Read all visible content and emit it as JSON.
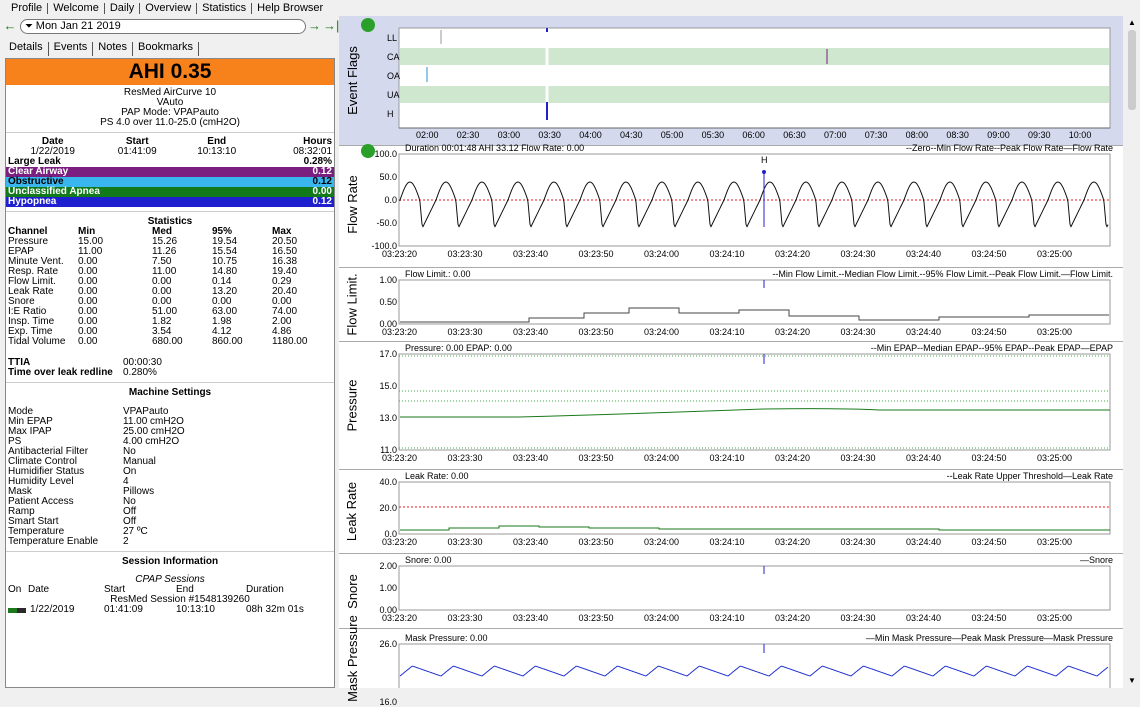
{
  "nav": {
    "tabs": [
      "Profile",
      "Welcome",
      "Daily",
      "Overview",
      "Statistics",
      "Help Browser"
    ]
  },
  "date": {
    "value": "Mon Jan 21 2019"
  },
  "subtabs": [
    "Details",
    "Events",
    "Notes",
    "Bookmarks"
  ],
  "summary": {
    "ahi": "AHI 0.35",
    "device": "ResMed AirCurve 10",
    "mode_short": "VAuto",
    "pap_mode": "PAP Mode: VPAPauto",
    "ps": "PS 4.0 over 11.0-25.0 (cmH2O)"
  },
  "session_head": {
    "labels": [
      "Date",
      "Start",
      "End",
      "Hours"
    ],
    "values": [
      "1/22/2019",
      "01:41:09",
      "10:13:10",
      "08:32:01"
    ]
  },
  "events": [
    {
      "label": "Large Leak",
      "value": "0.28%",
      "color": "#ffffff",
      "text": "#000000"
    },
    {
      "label": "Clear Airway",
      "value": "0.12",
      "color": "#7a1f7f",
      "text": "#ffffff"
    },
    {
      "label": "Obstructive",
      "value": "0.12",
      "color": "#3ab6ee",
      "text": "#000000"
    },
    {
      "label": "Unclassified Apnea",
      "value": "0.00",
      "color": "#137a1c",
      "text": "#ffffff"
    },
    {
      "label": "Hypopnea",
      "value": "0.12",
      "color": "#1e20cf",
      "text": "#ffffff"
    }
  ],
  "stats": {
    "title": "Statistics",
    "headers": [
      "Channel",
      "Min",
      "Med",
      "95%",
      "Max"
    ],
    "rows": [
      [
        "Pressure",
        "15.00",
        "15.26",
        "19.54",
        "20.50"
      ],
      [
        "EPAP",
        "11.00",
        "11.26",
        "15.54",
        "16.50"
      ],
      [
        "Minute Vent.",
        "0.00",
        "7.50",
        "10.75",
        "16.38"
      ],
      [
        "Resp. Rate",
        "0.00",
        "11.00",
        "14.80",
        "19.40"
      ],
      [
        "Flow Limit.",
        "0.00",
        "0.00",
        "0.14",
        "0.29"
      ],
      [
        "Leak Rate",
        "0.00",
        "0.00",
        "13.20",
        "20.40"
      ],
      [
        "Snore",
        "0.00",
        "0.00",
        "0.00",
        "0.00"
      ],
      [
        "I:E Ratio",
        "0.00",
        "51.00",
        "63.00",
        "74.00"
      ],
      [
        "Insp. Time",
        "0.00",
        "1.82",
        "1.98",
        "2.00"
      ],
      [
        "Exp. Time",
        "0.00",
        "3.54",
        "4.12",
        "4.86"
      ],
      [
        "Tidal Volume",
        "0.00",
        "680.00",
        "860.00",
        "1180.00"
      ]
    ]
  },
  "ttia": {
    "label": "TTIA",
    "value": "00:00:30",
    "leak_label": "Time over leak redline",
    "leak_value": "0.280%"
  },
  "machine": {
    "title": "Machine Settings",
    "rows": [
      [
        "Mode",
        "VPAPauto"
      ],
      [
        "Min EPAP",
        "11.00 cmH2O"
      ],
      [
        "Max IPAP",
        "25.00 cmH2O"
      ],
      [
        "PS",
        "4.00 cmH2O"
      ],
      [
        "Antibacterial Filter",
        "No"
      ],
      [
        "Climate Control",
        "Manual"
      ],
      [
        "Humidifier Status",
        "On"
      ],
      [
        "Humidity Level",
        "4"
      ],
      [
        "Mask",
        "Pillows"
      ],
      [
        "Patient Access",
        "No"
      ],
      [
        "Ramp",
        "Off"
      ],
      [
        "Smart Start",
        "Off"
      ],
      [
        "Temperature",
        "27 ºC"
      ],
      [
        "Temperature Enable",
        "2"
      ]
    ]
  },
  "session_info": {
    "title": "Session Information",
    "cpap": "CPAP Sessions",
    "headers": [
      "On",
      "Date",
      "Start",
      "End",
      "Duration"
    ],
    "session_name": "ResMed Session #1548139260",
    "row": [
      "1/22/2019",
      "01:41:09",
      "10:13:10",
      "08h 32m 01s"
    ]
  },
  "flags": {
    "label": "Event Flags",
    "rows": [
      "LL",
      "CA",
      "OA",
      "UA",
      "H"
    ],
    "xticks": [
      "02:00",
      "02:30",
      "03:00",
      "03:30",
      "04:00",
      "04:30",
      "05:00",
      "05:30",
      "06:00",
      "06:30",
      "07:00",
      "07:30",
      "08:00",
      "08:30",
      "09:00",
      "09:30",
      "10:00"
    ]
  },
  "time_ticks": [
    "03:23:20",
    "03:23:30",
    "03:23:40",
    "03:23:50",
    "03:24:00",
    "03:24:10",
    "03:24:20",
    "03:24:30",
    "03:24:40",
    "03:24:50",
    "03:25:00"
  ],
  "graphs": {
    "flow": {
      "label": "Flow Rate",
      "title": "Duration 00:01:48 AHI 33.12 Flow Rate: 0.00",
      "legend": "--Zero--Min Flow Rate--Peak Flow Rate—Flow Rate",
      "yticks": [
        "100.0",
        "50.0",
        "0.0",
        "-50.0",
        "-100.0"
      ],
      "marker": "H"
    },
    "flowlimit": {
      "label": "Flow Limit.",
      "title": "Flow Limit.: 0.00",
      "legend": "--Min Flow Limit.--Median Flow Limit.--95% Flow Limit.--Peak Flow Limit.—Flow Limit.",
      "yticks": [
        "1.00",
        "0.50",
        "0.00"
      ]
    },
    "pressure": {
      "label": "Pressure",
      "title": "Pressure: 0.00 EPAP: 0.00",
      "legend": "--Min EPAP--Median EPAP--95% EPAP--Peak EPAP—EPAP",
      "yticks": [
        "17.0",
        "15.0",
        "13.0",
        "11.0"
      ]
    },
    "leak": {
      "label": "Leak Rate",
      "title": "Leak Rate: 0.00",
      "legend": "--Leak Rate Upper Threshold—Leak Rate",
      "yticks": [
        "40.0",
        "20.0",
        "0.0"
      ]
    },
    "snore": {
      "label": "Snore",
      "title": "Snore: 0.00",
      "legend": "—Snore",
      "yticks": [
        "2.00",
        "1.00",
        "0.00"
      ]
    },
    "mask": {
      "label": "Mask Pressure",
      "title": "Mask Pressure: 0.00",
      "legend": "—Min Mask Pressure—Peak Mask Pressure—Mask Pressure",
      "yticks": [
        "26.0",
        "16.0"
      ]
    }
  }
}
